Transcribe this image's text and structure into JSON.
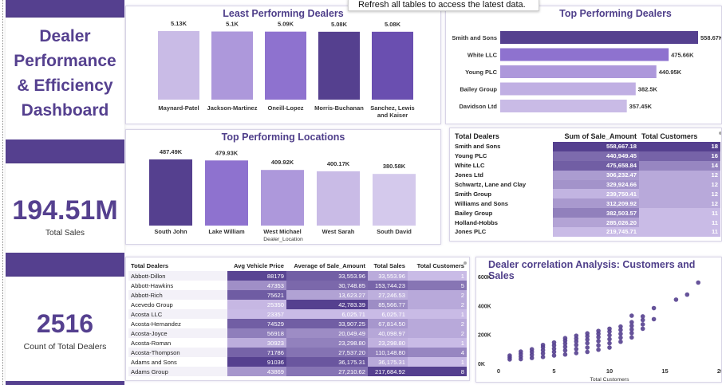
{
  "dashboard": {
    "title_lines": [
      "Dealer",
      "Performance",
      "& Efficiency",
      "Dashboard"
    ],
    "total_sales_value": "194.51M",
    "total_sales_label": "Total Sales",
    "dealer_count_value": "2516",
    "dealer_count_label": "Count of Total Dealers",
    "tooltip": "Refresh all tables to access the latest data."
  },
  "colors": {
    "dark": "#55408f",
    "mid": "#8a70cc",
    "light": "#c9bbe6",
    "panel_border": "#d8d4e6"
  },
  "chart_data": [
    {
      "type": "bar",
      "title": "Least Performing Dealers",
      "categories": [
        "Maynard-Patel",
        "Jackson-Martinez",
        "Oneill-Lopez",
        "Morris-Buchanan",
        "Sanchez, Lewis and Kaiser"
      ],
      "values": [
        5130,
        5100,
        5090,
        5080,
        5080
      ],
      "labels": [
        "5.13K",
        "5.1K",
        "5.09K",
        "5.08K",
        "5.08K"
      ]
    },
    {
      "type": "bar",
      "orientation": "horizontal",
      "title": "Top Performing Dealers",
      "categories": [
        "Smith and Sons",
        "White LLC",
        "Young PLC",
        "Bailey Group",
        "Davidson Ltd"
      ],
      "values": [
        558670,
        475660,
        440950,
        382500,
        357450
      ],
      "labels": [
        "558.67K",
        "475.66K",
        "440.95K",
        "382.5K",
        "357.45K"
      ]
    },
    {
      "type": "bar",
      "title": "Top Performing Locations",
      "xlabel": "Dealer_Location",
      "categories": [
        "South John",
        "Lake William",
        "West Michael",
        "West Sarah",
        "South David"
      ],
      "values": [
        487490,
        479930,
        409920,
        400170,
        380580
      ],
      "labels": [
        "487.49K",
        "479.93K",
        "409.92K",
        "400.17K",
        "380.58K"
      ]
    },
    {
      "type": "scatter",
      "title": "Dealer correlation Analysis: Customers and Sales",
      "xlabel": "Total Customers",
      "ylabel": "",
      "xlim": [
        0,
        20
      ],
      "ylim": [
        0,
        600000
      ],
      "xticks": [
        "0",
        "5",
        "10",
        "15",
        "20"
      ],
      "yticks": [
        "0K",
        "200K",
        "400K",
        "600K"
      ],
      "points": [
        [
          1,
          28000
        ],
        [
          1,
          42000
        ],
        [
          1,
          55000
        ],
        [
          2,
          30000
        ],
        [
          2,
          48000
        ],
        [
          2,
          66000
        ],
        [
          2,
          82000
        ],
        [
          3,
          38000
        ],
        [
          3,
          60000
        ],
        [
          3,
          80000
        ],
        [
          3,
          98000
        ],
        [
          4,
          45000
        ],
        [
          4,
          70000
        ],
        [
          4,
          92000
        ],
        [
          4,
          112000
        ],
        [
          4,
          128000
        ],
        [
          5,
          55000
        ],
        [
          5,
          80000
        ],
        [
          5,
          102000
        ],
        [
          5,
          125000
        ],
        [
          5,
          145000
        ],
        [
          6,
          62000
        ],
        [
          6,
          90000
        ],
        [
          6,
          115000
        ],
        [
          6,
          138000
        ],
        [
          6,
          158000
        ],
        [
          6,
          175000
        ],
        [
          7,
          72000
        ],
        [
          7,
          100000
        ],
        [
          7,
          128000
        ],
        [
          7,
          152000
        ],
        [
          7,
          172000
        ],
        [
          7,
          192000
        ],
        [
          8,
          80000
        ],
        [
          8,
          110000
        ],
        [
          8,
          140000
        ],
        [
          8,
          165000
        ],
        [
          8,
          188000
        ],
        [
          8,
          208000
        ],
        [
          9,
          95000
        ],
        [
          9,
          125000
        ],
        [
          9,
          155000
        ],
        [
          9,
          182000
        ],
        [
          9,
          205000
        ],
        [
          9,
          225000
        ],
        [
          10,
          110000
        ],
        [
          10,
          140000
        ],
        [
          10,
          168000
        ],
        [
          10,
          195000
        ],
        [
          10,
          220000
        ],
        [
          10,
          240000
        ],
        [
          11,
          150000
        ],
        [
          11,
          178000
        ],
        [
          11,
          205000
        ],
        [
          11,
          232000
        ],
        [
          11,
          255000
        ],
        [
          12,
          180000
        ],
        [
          12,
          210000
        ],
        [
          12,
          235000
        ],
        [
          12,
          260000
        ],
        [
          12,
          285000
        ],
        [
          12,
          330000
        ],
        [
          13,
          240000
        ],
        [
          13,
          270000
        ],
        [
          13,
          300000
        ],
        [
          13,
          325000
        ],
        [
          14,
          382500
        ],
        [
          14,
          306000
        ],
        [
          16,
          440950
        ],
        [
          17,
          475660
        ],
        [
          18,
          558670
        ]
      ]
    }
  ],
  "top_table": {
    "headers": [
      "Total Dealers",
      "Sum of Sale_Amount",
      "Total Customers"
    ],
    "rows": [
      [
        "Smith and Sons",
        "558,667.18",
        "18"
      ],
      [
        "Young PLC",
        "440,949.45",
        "16"
      ],
      [
        "White LLC",
        "475,658.84",
        "14"
      ],
      [
        "Jones Ltd",
        "306,232.47",
        "12"
      ],
      [
        "Schwartz, Lane and Clay",
        "329,924.66",
        "12"
      ],
      [
        "Smith Group",
        "239,750.41",
        "12"
      ],
      [
        "Williams and Sons",
        "312,209.92",
        "12"
      ],
      [
        "Bailey Group",
        "382,503.57",
        "11"
      ],
      [
        "Holland-Hobbs",
        "285,026.20",
        "11"
      ],
      [
        "Jones PLC",
        "219,745.71",
        "11"
      ]
    ]
  },
  "detail_table": {
    "headers": [
      "Total Dealers",
      "Avg Vehicle Price",
      "Average of Sale_Amount",
      "Total Sales",
      "Total Customers"
    ],
    "rows": [
      [
        "Abbott-Dillon",
        "88179",
        "33,553.96",
        "33,553.96",
        "1"
      ],
      [
        "Abbott-Hawkins",
        "47353",
        "30,748.85",
        "153,744.23",
        "5"
      ],
      [
        "Abbott-Rich",
        "75621",
        "13,623.27",
        "27,246.53",
        "2"
      ],
      [
        "Acevedo Group",
        "25350",
        "42,783.39",
        "85,566.77",
        "2"
      ],
      [
        "Acosta LLC",
        "23357",
        "6,025.71",
        "6,025.71",
        "1"
      ],
      [
        "Acosta-Hernandez",
        "74529",
        "33,907.25",
        "67,814.50",
        "2"
      ],
      [
        "Acosta-Joyce",
        "56918",
        "20,049.49",
        "40,098.97",
        "2"
      ],
      [
        "Acosta-Roman",
        "30923",
        "23,298.80",
        "23,298.80",
        "1"
      ],
      [
        "Acosta-Thompson",
        "71786",
        "27,537.20",
        "110,148.80",
        "4"
      ],
      [
        "Adams and Sons",
        "91036",
        "36,175.31",
        "36,175.31",
        "1"
      ],
      [
        "Adams Group",
        "43869",
        "27,210.62",
        "217,684.92",
        "8"
      ]
    ]
  }
}
